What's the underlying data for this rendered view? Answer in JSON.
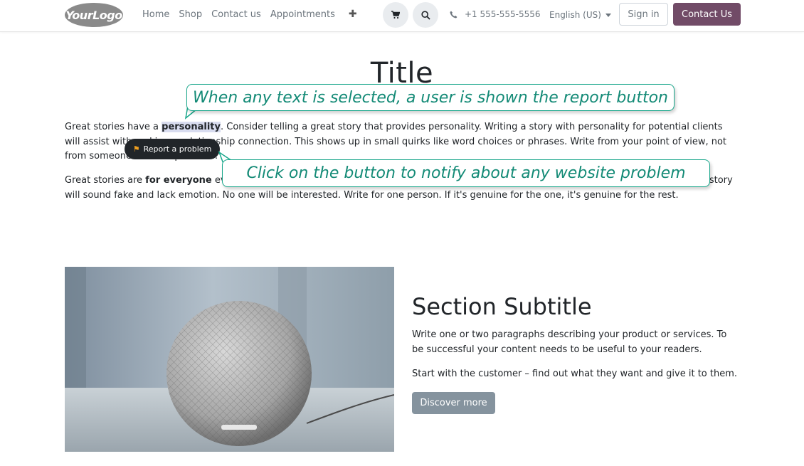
{
  "header": {
    "logo": "YourLogo",
    "nav_items": [
      "Home",
      "Shop",
      "Contact us",
      "Appointments"
    ],
    "phone": "+1 555-555-5556",
    "language": "English (US)",
    "sign_in": "Sign in",
    "contact_us": "Contact Us"
  },
  "page": {
    "title": "Title",
    "p1_before": "Great stories have a ",
    "p1_selected": "personality",
    "p1_after": ". Consider telling a great story that provides personality. Writing a story with personality for potential clients will assist with making a relationship connection. This shows up in small quirks like word choices or phrases. Write from your point of view, not from someone else's experience.",
    "p2_before": "Great stories are ",
    "p2_bold": "for everyone",
    "p2_after": " even when only written for just one person. If you try to write with a wide, general audience in mind, your story will sound fake and lack emotion. No one will be interested. Write for one person. If it's genuine for the one, it's genuine for the rest.",
    "report_button": "Report a problem"
  },
  "callouts": {
    "c1": "When any text is selected, a user is shown the report button",
    "c2": "Click on the button to notify about any website problem"
  },
  "section": {
    "subtitle": "Section Subtitle",
    "p1": "Write one or two paragraphs describing your product or services. To be successful your content needs to be useful to your readers.",
    "p2": "Start with the customer – find out what they want and give it to them.",
    "button": "Discover more"
  },
  "colors": {
    "brand": "#714b67",
    "callout": "#17a68a",
    "discover": "#85939e"
  }
}
